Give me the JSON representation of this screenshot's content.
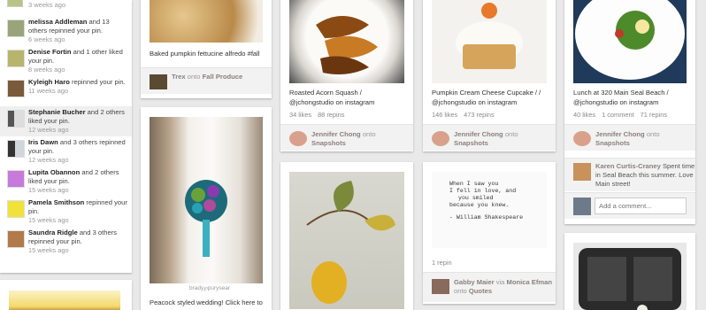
{
  "activity_feed": {
    "top_timestamp": "3 weeks ago",
    "items": [
      {
        "name": "melissa Addleman",
        "rest": " and 13 others repinned your pin.",
        "time": "6 weeks ago"
      },
      {
        "name": "Denise Fortin",
        "rest": " and 1 other liked your pin.",
        "time": "8 weeks ago"
      },
      {
        "name": "Kyleigh Haro",
        "rest": " repinned your pin.",
        "time": "11 weeks ago"
      },
      {
        "name": "Stephanie Bucher",
        "rest": " and 2 others liked your pin.",
        "time": "12 weeks ago"
      },
      {
        "name": "Iris Dawn",
        "rest": " and 3 others repinned your pin.",
        "time": "12 weeks ago"
      },
      {
        "name": "Lupita Obannon",
        "rest": " and 2 others liked your pin.",
        "time": "15 weeks ago"
      },
      {
        "name": "Pamela Smithson",
        "rest": " repinned your pin.",
        "time": "15 weeks ago"
      },
      {
        "name": "Saundra Ridgle",
        "rest": " and 3 others repinned your pin.",
        "time": "15 weeks ago"
      }
    ]
  },
  "pins": {
    "fettuccine": {
      "description": "Baked pumpkin fettucine alfredo #fall",
      "credit_user": "Trex",
      "credit_onto": " onto ",
      "credit_board": "Fall Produce"
    },
    "wedding": {
      "photo_credit": "brady℘purysear",
      "description": "Peacock styled wedding! Click here to"
    },
    "squash": {
      "description": "Roasted Acorn Squash / @jchongstudio on instagram",
      "likes": "34 likes",
      "repins": "88 repins",
      "credit_user": "Jennifer Chong",
      "credit_onto": " onto ",
      "credit_board": "Snapshots"
    },
    "cupcake": {
      "description": "Pumpkin Cream Cheese Cupcake / / @jchongstudio on instagram",
      "likes": "146 likes",
      "repins": "473 repins",
      "credit_user": "Jennifer Chong",
      "credit_onto": " onto ",
      "credit_board": "Snapshots"
    },
    "quote": {
      "lines": [
        "When I saw you",
        "I fell in love, and",
        "you smiled",
        "because you knew.",
        "",
        "- William Shakespeare"
      ],
      "repins": "1 repin",
      "credit_user": "Gabby Maier",
      "credit_via": " via ",
      "credit_via_user": "Monica Efman",
      "credit_onto": " onto ",
      "credit_board": "Quotes"
    },
    "lunch": {
      "description": "Lunch at 320 Main Seal Beach / @jchongstudio on instagram",
      "likes": "40 likes",
      "comments": "1 comment",
      "repins": "71 repins",
      "credit_user": "Jennifer Chong",
      "credit_onto": " onto ",
      "credit_board": "Snapshots",
      "comment_user": "Karen Curtis-Craney",
      "comment_text": " Spent time in Seal Beach this summer. Love Main street!",
      "add_comment_placeholder": "Add a comment..."
    }
  },
  "colors": {
    "background": "#e9e9e9",
    "credit_bar": "#f2f2f2",
    "username": "#8c7e7e"
  }
}
